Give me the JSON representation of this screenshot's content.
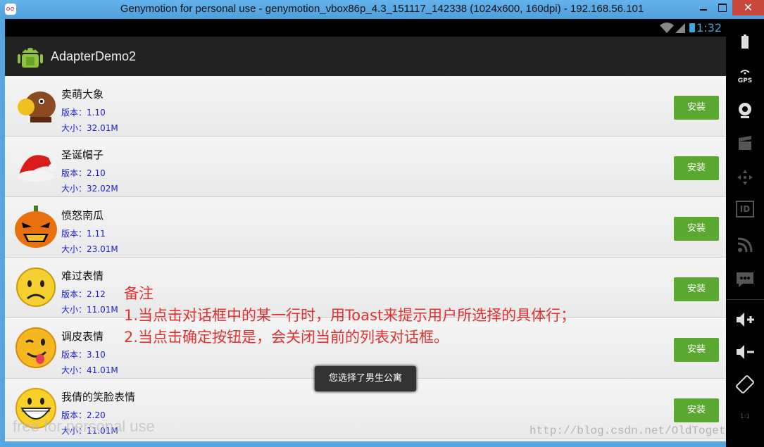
{
  "window": {
    "title": "Genymotion for personal use - genymotion_vbox86p_4.3_151117_142338 (1024x600, 160dpi) - 192.168.56.101",
    "close": "✕"
  },
  "status": {
    "time": "1:32"
  },
  "app": {
    "title": "AdapterDemo2",
    "icon": "android-icon"
  },
  "items": [
    {
      "name": "卖萌大象",
      "version": "版本：1.10",
      "size": "大小：32.01M",
      "button": "安装",
      "icon": "mammoth-icon"
    },
    {
      "name": "圣诞帽子",
      "version": "版本：2.10",
      "size": "大小：32.02M",
      "button": "安装",
      "icon": "santa-hat-icon"
    },
    {
      "name": "愤怒南瓜",
      "version": "版本：1.11",
      "size": "大小：23.01M",
      "button": "安装",
      "icon": "pumpkin-icon"
    },
    {
      "name": "难过表情",
      "version": "版本：2.12",
      "size": "大小：11.01M",
      "button": "安装",
      "icon": "sad-face-icon"
    },
    {
      "name": "调皮表情",
      "version": "版本：3.10",
      "size": "大小：41.01M",
      "button": "安装",
      "icon": "tongue-face-icon"
    },
    {
      "name": "我倩的笑脸表情",
      "version": "版本：2.20",
      "size": "大小：11.01M",
      "button": "安装",
      "icon": "laugh-face-icon"
    }
  ],
  "note": {
    "title": "备注",
    "line1": "1.当点击对话框中的某一行时，用Toast来提示用户所选择的具体行；",
    "line2": "2.当点击确定按钮是，会关闭当前的列表对话框。"
  },
  "toast": "您选择了男生公寓",
  "watermark": {
    "left": "free for personal use",
    "right": "http://blog.csdn.net/OldTogether"
  },
  "sidebar": [
    "battery-icon",
    "gps-icon",
    "camera-icon",
    "video-capture-icon",
    "dpad-icon",
    "device-id-icon",
    "rss-icon",
    "sms-icon",
    "volume-up-icon",
    "volume-down-icon",
    "rotate-icon",
    "pixel-perfect-icon"
  ],
  "sidebar_labels": {
    "gps": "GPS",
    "id": "ID",
    "pixel": "1:1"
  },
  "colors": {
    "install": "#5aa830",
    "note": "#e03030",
    "clock": "#3aa9d9"
  }
}
